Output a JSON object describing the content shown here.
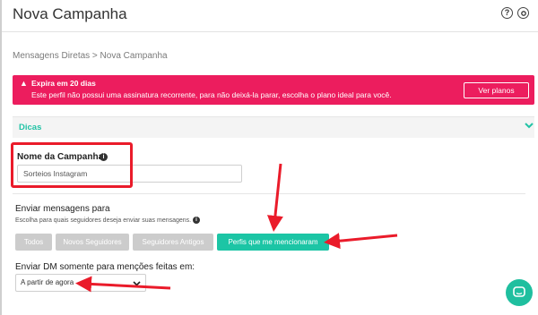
{
  "header": {
    "title": "Nova Campanha",
    "help_icon": "?",
    "settings_icon": "gear-icon"
  },
  "breadcrumb": "Mensagens Diretas > Nova Campanha",
  "alert": {
    "title": "Expira em 20 dias",
    "text": "Este perfil não possui uma assinatura recorrente, para não deixá-la parar, escolha o plano ideal para você.",
    "button": "Ver planos",
    "icon": "warning-icon",
    "color": "#ec1d5e"
  },
  "tips": {
    "label": "Dicas",
    "accent": "#22c3a6"
  },
  "campaign": {
    "label": "Nome da Campanha",
    "value": "Sorteios Instagram"
  },
  "send": {
    "label": "Enviar mensagens para",
    "help": "Escolha para quais seguidores deseja enviar suas mensagens.",
    "options": [
      "Todos",
      "Novos Seguidores",
      "Seguidores Antigos",
      "Perfis que me mencionaram"
    ],
    "selected": "Perfis que me mencionaram",
    "selected_color": "#1cc5a5"
  },
  "dm": {
    "label": "Enviar DM somente para menções feitas em:",
    "value": "A partir de agora"
  },
  "chat": {
    "icon": "chat-icon"
  },
  "annotation_color": "#ea1b2a"
}
